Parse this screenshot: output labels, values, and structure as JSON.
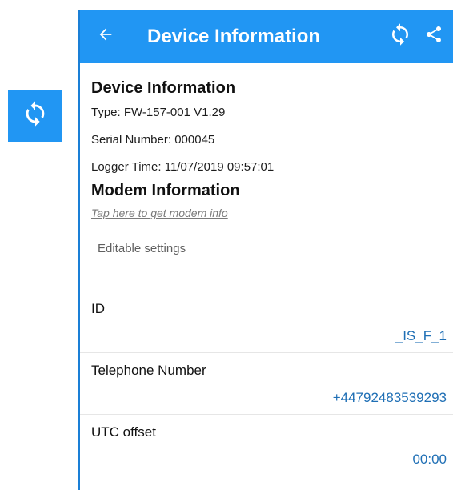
{
  "appbar": {
    "title": "Device Information",
    "back_icon": "arrow-back-icon",
    "refresh_icon": "sync-icon",
    "share_icon": "share-icon",
    "color": "#2196f3"
  },
  "side_button": {
    "icon": "sync-icon",
    "color": "#2196f3"
  },
  "device_info": {
    "heading": "Device Information",
    "type": "Type: FW-157-001 V1.29",
    "serial": "Serial Number:  000045",
    "logger_time": "Logger Time: 11/07/2019 09:57:01"
  },
  "modem_info": {
    "heading": "Modem Information",
    "link": "Tap here to get modem info"
  },
  "editable_label": "Editable settings",
  "settings": [
    {
      "name": "ID",
      "value": "_IS_F_1"
    },
    {
      "name": "Telephone Number",
      "value": "+44792483539293"
    },
    {
      "name": "UTC offset",
      "value": "00:00"
    }
  ]
}
